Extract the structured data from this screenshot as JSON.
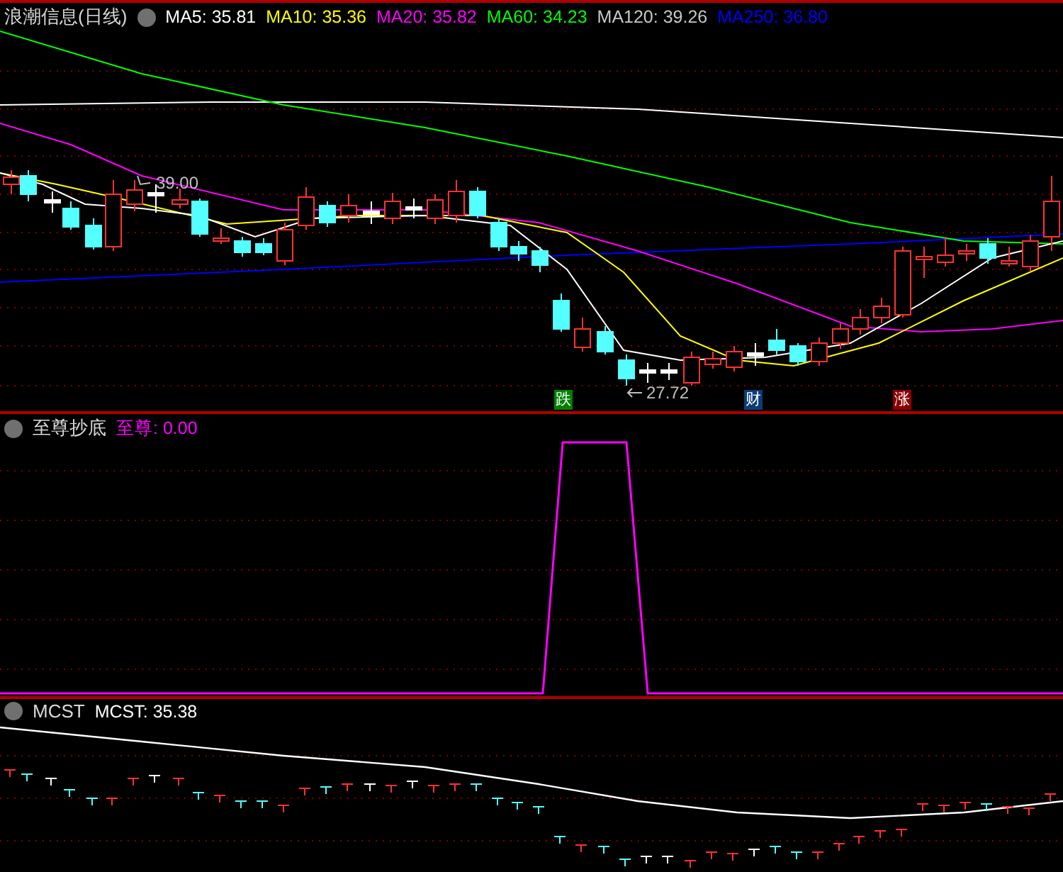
{
  "main_panel": {
    "title": "浪潮信息(日线)",
    "ma_values": [
      {
        "label": "MA5: 35.81",
        "color": "#ffffff"
      },
      {
        "label": "MA10: 35.36",
        "color": "#ffff00"
      },
      {
        "label": "MA20: 35.82",
        "color": "#ff00ff"
      },
      {
        "label": "MA60: 34.23",
        "color": "#00ff00"
      },
      {
        "label": "MA120: 39.26",
        "color": "#c8c8c8"
      },
      {
        "label": "MA250: 36.80",
        "color": "#0000ff"
      }
    ],
    "price_labels": [
      {
        "text": "39.00"
      },
      {
        "text": "27.72"
      }
    ],
    "markers": [
      {
        "text": "跌",
        "color": "#008000"
      },
      {
        "text": "财",
        "color": "#0a3c78"
      },
      {
        "text": "涨",
        "color": "#8c0000"
      }
    ]
  },
  "indicator_panel": {
    "title": "至尊抄底",
    "series_label": "至尊",
    "value": ": 0.00",
    "color": "#ff00ff"
  },
  "mcst_panel": {
    "title": "MCST",
    "readout": "MCST: 35.38"
  }
}
